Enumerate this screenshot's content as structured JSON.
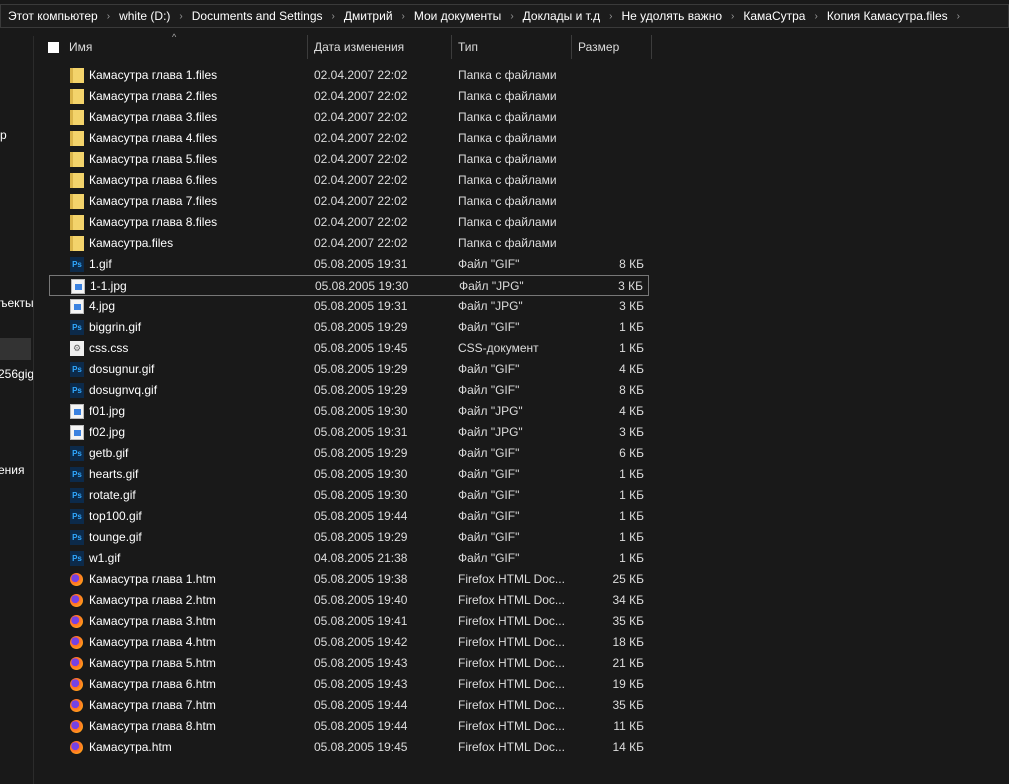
{
  "breadcrumb": [
    "Этот компьютер",
    "white (D:)",
    "Documents and Settings",
    "Дмитрий",
    "Мои документы",
    "Доклады и т.д",
    "Не удолять важно",
    "КамаСутра",
    "Копия Камасутра.files"
  ],
  "nav": [
    "р",
    "ъекты",
    "256gig",
    "ения"
  ],
  "columns": {
    "name": "Имя",
    "date": "Дата изменения",
    "type": "Тип",
    "size": "Размер"
  },
  "files": [
    {
      "name": "Камасутра  глава 1.files",
      "date": "02.04.2007 22:02",
      "type": "Папка с файлами",
      "size": "",
      "icon": "folder"
    },
    {
      "name": "Камасутра  глава 2.files",
      "date": "02.04.2007 22:02",
      "type": "Папка с файлами",
      "size": "",
      "icon": "folder"
    },
    {
      "name": "Камасутра  глава 3.files",
      "date": "02.04.2007 22:02",
      "type": "Папка с файлами",
      "size": "",
      "icon": "folder"
    },
    {
      "name": "Камасутра  глава 4.files",
      "date": "02.04.2007 22:02",
      "type": "Папка с файлами",
      "size": "",
      "icon": "folder"
    },
    {
      "name": "Камасутра  глава 5.files",
      "date": "02.04.2007 22:02",
      "type": "Папка с файлами",
      "size": "",
      "icon": "folder"
    },
    {
      "name": "Камасутра  глава 6.files",
      "date": "02.04.2007 22:02",
      "type": "Папка с файлами",
      "size": "",
      "icon": "folder"
    },
    {
      "name": "Камасутра  глава 7.files",
      "date": "02.04.2007 22:02",
      "type": "Папка с файлами",
      "size": "",
      "icon": "folder"
    },
    {
      "name": "Камасутра  глава 8.files",
      "date": "02.04.2007 22:02",
      "type": "Папка с файлами",
      "size": "",
      "icon": "folder"
    },
    {
      "name": "Камасутра.files",
      "date": "02.04.2007 22:02",
      "type": "Папка с файлами",
      "size": "",
      "icon": "folder"
    },
    {
      "name": "1.gif",
      "date": "05.08.2005 19:31",
      "type": "Файл \"GIF\"",
      "size": "8 КБ",
      "icon": "ps"
    },
    {
      "name": "1-1.jpg",
      "date": "05.08.2005 19:30",
      "type": "Файл \"JPG\"",
      "size": "3 КБ",
      "icon": "img",
      "selected": true
    },
    {
      "name": "4.jpg",
      "date": "05.08.2005 19:31",
      "type": "Файл \"JPG\"",
      "size": "3 КБ",
      "icon": "img"
    },
    {
      "name": "biggrin.gif",
      "date": "05.08.2005 19:29",
      "type": "Файл \"GIF\"",
      "size": "1 КБ",
      "icon": "ps"
    },
    {
      "name": "css.css",
      "date": "05.08.2005 19:45",
      "type": "CSS-документ",
      "size": "1 КБ",
      "icon": "css"
    },
    {
      "name": "dosugnur.gif",
      "date": "05.08.2005 19:29",
      "type": "Файл \"GIF\"",
      "size": "4 КБ",
      "icon": "ps"
    },
    {
      "name": "dosugnvq.gif",
      "date": "05.08.2005 19:29",
      "type": "Файл \"GIF\"",
      "size": "8 КБ",
      "icon": "ps"
    },
    {
      "name": "f01.jpg",
      "date": "05.08.2005 19:30",
      "type": "Файл \"JPG\"",
      "size": "4 КБ",
      "icon": "img"
    },
    {
      "name": "f02.jpg",
      "date": "05.08.2005 19:31",
      "type": "Файл \"JPG\"",
      "size": "3 КБ",
      "icon": "img"
    },
    {
      "name": "getb.gif",
      "date": "05.08.2005 19:29",
      "type": "Файл \"GIF\"",
      "size": "6 КБ",
      "icon": "ps"
    },
    {
      "name": "hearts.gif",
      "date": "05.08.2005 19:30",
      "type": "Файл \"GIF\"",
      "size": "1 КБ",
      "icon": "ps"
    },
    {
      "name": "rotate.gif",
      "date": "05.08.2005 19:30",
      "type": "Файл \"GIF\"",
      "size": "1 КБ",
      "icon": "ps"
    },
    {
      "name": "top100.gif",
      "date": "05.08.2005 19:44",
      "type": "Файл \"GIF\"",
      "size": "1 КБ",
      "icon": "ps"
    },
    {
      "name": "tounge.gif",
      "date": "05.08.2005 19:29",
      "type": "Файл \"GIF\"",
      "size": "1 КБ",
      "icon": "ps"
    },
    {
      "name": "w1.gif",
      "date": "04.08.2005 21:38",
      "type": "Файл \"GIF\"",
      "size": "1 КБ",
      "icon": "ps"
    },
    {
      "name": "Камасутра  глава 1.htm",
      "date": "05.08.2005 19:38",
      "type": "Firefox HTML Doc...",
      "size": "25 КБ",
      "icon": "ff"
    },
    {
      "name": "Камасутра  глава 2.htm",
      "date": "05.08.2005 19:40",
      "type": "Firefox HTML Doc...",
      "size": "34 КБ",
      "icon": "ff"
    },
    {
      "name": "Камасутра  глава 3.htm",
      "date": "05.08.2005 19:41",
      "type": "Firefox HTML Doc...",
      "size": "35 КБ",
      "icon": "ff"
    },
    {
      "name": "Камасутра  глава 4.htm",
      "date": "05.08.2005 19:42",
      "type": "Firefox HTML Doc...",
      "size": "18 КБ",
      "icon": "ff"
    },
    {
      "name": "Камасутра  глава 5.htm",
      "date": "05.08.2005 19:43",
      "type": "Firefox HTML Doc...",
      "size": "21 КБ",
      "icon": "ff"
    },
    {
      "name": "Камасутра  глава 6.htm",
      "date": "05.08.2005 19:43",
      "type": "Firefox HTML Doc...",
      "size": "19 КБ",
      "icon": "ff"
    },
    {
      "name": "Камасутра  глава 7.htm",
      "date": "05.08.2005 19:44",
      "type": "Firefox HTML Doc...",
      "size": "35 КБ",
      "icon": "ff"
    },
    {
      "name": "Камасутра  глава 8.htm",
      "date": "05.08.2005 19:44",
      "type": "Firefox HTML Doc...",
      "size": "11 КБ",
      "icon": "ff"
    },
    {
      "name": "Камасутра.htm",
      "date": "05.08.2005 19:45",
      "type": "Firefox HTML Doc...",
      "size": "14 КБ",
      "icon": "ff"
    }
  ]
}
